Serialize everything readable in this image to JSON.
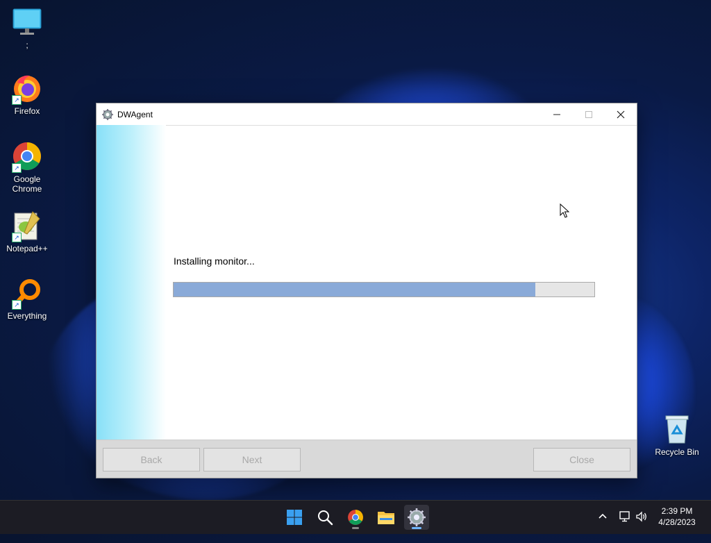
{
  "desktop": {
    "icons": [
      {
        "label": ";"
      },
      {
        "label": "Firefox"
      },
      {
        "label": "Google Chrome"
      },
      {
        "label": "Notepad++"
      },
      {
        "label": "Everything"
      },
      {
        "label": "Recycle Bin"
      }
    ]
  },
  "window": {
    "title": "DWAgent",
    "status_text": "Installing monitor...",
    "progress_percent": 86,
    "buttons": {
      "back": "Back",
      "next": "Next",
      "close": "Close"
    }
  },
  "taskbar": {
    "time": "2:39 PM",
    "date": "4/28/2023"
  },
  "colors": {
    "progress_fill": "#8aaad8",
    "sidebar_accent": "#88e0f8"
  }
}
